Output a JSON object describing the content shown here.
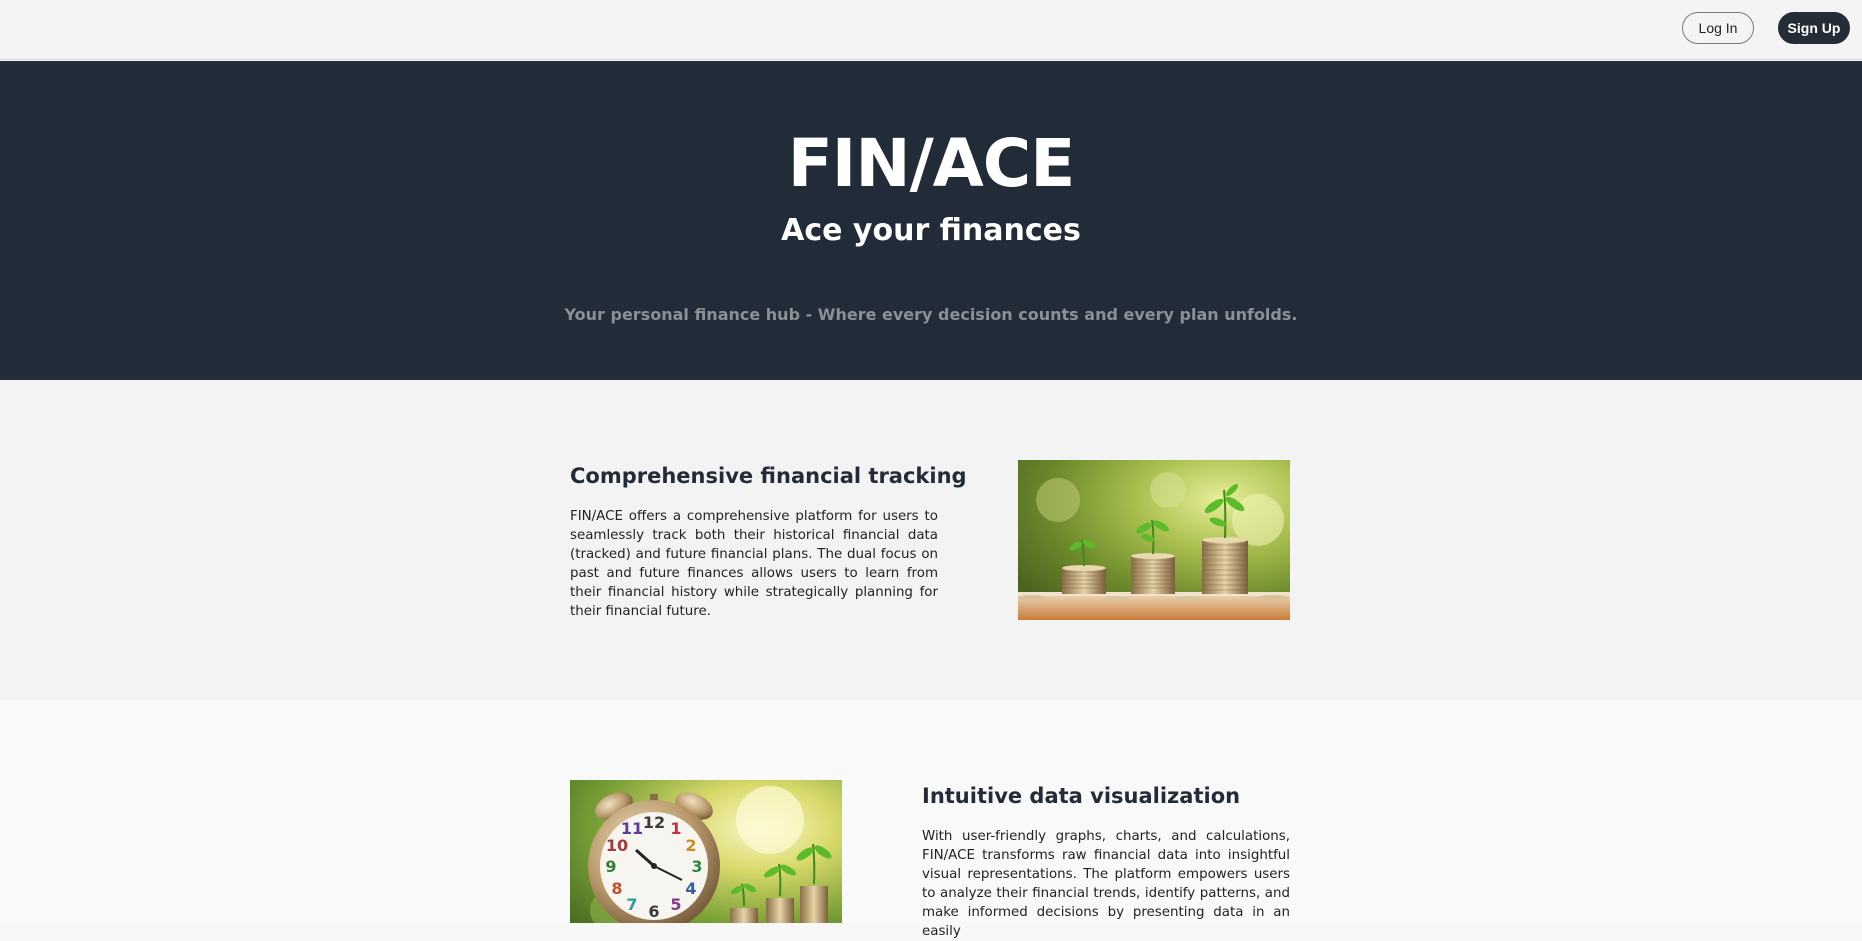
{
  "nav": {
    "login_label": "Log In",
    "signup_label": "Sign Up"
  },
  "hero": {
    "title": "FIN/ACE",
    "tagline": "Ace your finances",
    "subtitle": "Your personal finance hub - Where every decision counts and every plan unfolds."
  },
  "features": [
    {
      "title": "Comprehensive financial tracking",
      "body": "FIN/ACE offers a comprehensive platform for users to seamlessly track both their historical financial data (tracked) and future financial plans. The dual focus on past and future finances allows users to learn from their financial history while strategically planning for their financial future.",
      "image": "coin-stacks-with-plants"
    },
    {
      "title": "Intuitive data visualization",
      "body": "With user-friendly graphs, charts, and calculations, FIN/ACE transforms raw financial data into insightful visual representations. The platform empowers users to analyze their financial trends, identify patterns, and make informed decisions by presenting data in an easily",
      "image": "alarm-clock-with-coins"
    }
  ],
  "colors": {
    "navy": "#222c38",
    "nav_bg": "#f4f4f4",
    "muted_text": "#8a9096"
  }
}
